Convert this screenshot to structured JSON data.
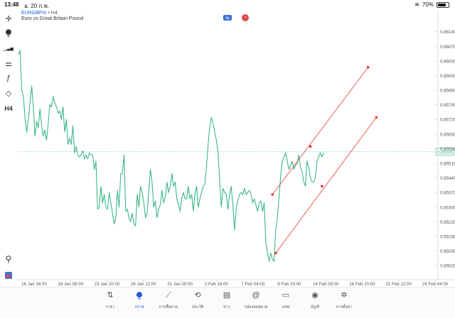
{
  "status": {
    "time": "13:48",
    "date": "อ. 20 ก.พ.",
    "battery": "70%",
    "battery_level": 0.7
  },
  "chart_header": {
    "symbol": "EURGBPm",
    "separator": "•",
    "timeframe": "H4",
    "description": "Euro vs Great Britain Pound"
  },
  "chart_data": {
    "type": "line",
    "line_color": "#3bb886",
    "trendline_color": "#e53935",
    "current_price": "0.85565",
    "y_ticks": [
      "0.86140",
      "0.86070",
      "0.86000",
      "0.85930",
      "0.85860",
      "0.85790",
      "0.85720",
      "0.85650",
      "0.85580",
      "0.85510",
      "0.85440",
      "0.85370",
      "0.85300",
      "0.85230",
      "0.85160",
      "0.85090",
      "0.85020"
    ],
    "ylim": [
      0.85,
      0.8619
    ],
    "x_ticks": [
      "16 Jan 16:00",
      "19 Jan 08:00",
      "23 Jan 20:00",
      "26 Jan 12:00",
      "31 Jan 00:00",
      "2 Feb 16:00",
      "7 Feb 04:00",
      "9 Feb 20:00",
      "14 Feb 08:00",
      "18 Feb 20:00",
      "21 Feb 12:00",
      "24 Feb 04:00"
    ],
    "values": [
      0.8603,
      0.8605,
      0.8586,
      0.8583,
      0.8572,
      0.8566,
      0.8572,
      0.858,
      0.8588,
      0.8578,
      0.8564,
      0.8571,
      0.8568,
      0.8577,
      0.8569,
      0.8564,
      0.8567,
      0.8562,
      0.857,
      0.8579,
      0.8578,
      0.8583,
      0.858,
      0.8578,
      0.8575,
      0.8576,
      0.8572,
      0.8578,
      0.8566,
      0.8572,
      0.856,
      0.8563,
      0.856,
      0.8569,
      0.8556,
      0.8559,
      0.8555,
      0.8554,
      0.8555,
      0.8557,
      0.8553,
      0.8555,
      0.8553,
      0.8556,
      0.8555,
      0.8555,
      0.8548,
      0.8552,
      0.8529,
      0.853,
      0.854,
      0.8532,
      0.8536,
      0.853,
      0.8529,
      0.8537,
      0.8532,
      0.8527,
      0.8522,
      0.8525,
      0.8538,
      0.853,
      0.8546,
      0.8546,
      0.8555,
      0.8528,
      0.8529,
      0.8525,
      0.8523,
      0.8527,
      0.8522,
      0.8521,
      0.8536,
      0.853,
      0.854,
      0.8537,
      0.8532,
      0.8525,
      0.8527,
      0.8538,
      0.8548,
      0.8542,
      0.853,
      0.8533,
      0.8525,
      0.8529,
      0.8531,
      0.8538,
      0.8532,
      0.8535,
      0.8542,
      0.8537,
      0.854,
      0.8546,
      0.854,
      0.8542,
      0.8534,
      0.8531,
      0.8528,
      0.8534,
      0.8537,
      0.8534,
      0.8534,
      0.854,
      0.8534,
      0.8536,
      0.8528,
      0.8536,
      0.854,
      0.853,
      0.8534,
      0.8537,
      0.854,
      0.8541,
      0.8549,
      0.856,
      0.8569,
      0.8573,
      0.857,
      0.8566,
      0.8562,
      0.8556,
      0.8542,
      0.853,
      0.8539,
      0.8537,
      0.8536,
      0.8529,
      0.8536,
      0.854,
      0.8531,
      0.8519,
      0.8529,
      0.8533,
      0.8536,
      0.8537,
      0.8536,
      0.8539,
      0.8536,
      0.8537,
      0.8538,
      0.8536,
      0.8532,
      0.8534,
      0.8531,
      0.8528,
      0.8532,
      0.8533,
      0.8528,
      0.8532,
      0.8513,
      0.8508,
      0.8504,
      0.8508,
      0.8505,
      0.8504,
      0.8519,
      0.8525,
      0.8535,
      0.8545,
      0.8552,
      0.8554,
      0.8556,
      0.8552,
      0.8548,
      0.855,
      0.8552,
      0.8548,
      0.855,
      0.8551,
      0.8555,
      0.8549,
      0.8547,
      0.8542,
      0.854,
      0.8552,
      0.8549,
      0.8544,
      0.8542,
      0.8542,
      0.8544,
      0.8552,
      0.8554,
      0.8556,
      0.8554,
      0.8556
    ],
    "trendlines": [
      {
        "from": {
          "index": 154,
          "price": 0.8536
        },
        "to": {
          "index": 212,
          "price": 0.8597
        }
      },
      {
        "from": {
          "index": 156,
          "price": 0.8508
        },
        "to": {
          "index": 217,
          "price": 0.8573
        }
      }
    ],
    "trendline_points": [
      {
        "index": 177,
        "price": 0.8559
      },
      {
        "index": 184,
        "price": 0.854
      }
    ]
  },
  "toolbar": {
    "tools": [
      {
        "icon": "crosshair-icon",
        "glyph": "✛"
      },
      {
        "icon": "candlestick-icon",
        "glyph": "⧭"
      },
      {
        "icon": "indicators-icon",
        "glyph": "▁▃▅"
      },
      {
        "icon": "settings-sliders-icon",
        "glyph": "⚌"
      },
      {
        "icon": "function-icon",
        "glyph": "ƒ"
      },
      {
        "icon": "shapes-icon",
        "glyph": "◇"
      },
      {
        "icon": "timeframe-label",
        "glyph": "H4"
      }
    ]
  },
  "nav": {
    "items": [
      {
        "label": "ราคา",
        "icon": "⇅"
      },
      {
        "label": "กราฟ",
        "icon": "⧭"
      },
      {
        "label": "การซื้อขาย",
        "icon": "⟋"
      },
      {
        "label": "ประวัติ",
        "icon": "⟲"
      },
      {
        "label": "ข่าว",
        "icon": "▤"
      },
      {
        "label": "กล่องจดหมาย",
        "icon": "@"
      },
      {
        "label": "แชท",
        "icon": "▭"
      },
      {
        "label": "บัญชี",
        "icon": "◉"
      },
      {
        "label": "การตั้งค่า",
        "icon": "✲"
      }
    ],
    "active_index": 1
  }
}
